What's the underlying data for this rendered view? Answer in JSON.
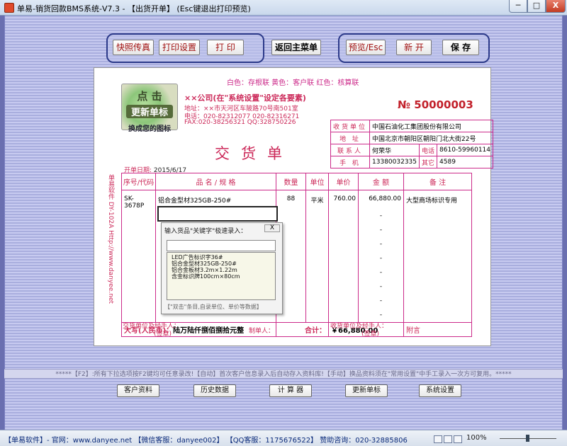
{
  "window": {
    "title": "单易-销货回款BMS系统-V7.3 - 【出货开单】     (Esc键退出打印预览)",
    "min_label": "─",
    "max_label": "□",
    "close_label": "X"
  },
  "toolbar": {
    "snapshot_fax": "快照传真",
    "print_settings": "打印设置",
    "print": "打 印",
    "back_main_menu": "返回主菜单",
    "preview_esc": "预览/Esc",
    "new_doc": "新 开",
    "save": "保 存"
  },
  "document": {
    "color_legend": "白色：存根联    黄色：客户联    红色：核算联",
    "logo": {
      "line1": "点 击",
      "line2": "更新单标",
      "line3": "换成您的图标"
    },
    "company_name": "××公司(在\"系统设置\"设定各要素)",
    "address": "地址：××市天河区车陂路70号南501室",
    "phone": "电话：020-82312077   020-82316271",
    "fax_qq": "FAX:020-38256321 QQ:328750226",
    "doc_number": "№ 50000003",
    "doc_title": "交货单",
    "date_label": "开单日期:",
    "date_value": "2015/6/17",
    "side_text": "单易软件 DY-102A  Http://www.danyee.net",
    "customer": {
      "unit_label": "收货单位",
      "unit_value": "中国石油化工集团股份有限公司",
      "addr_label": "地 址",
      "addr_value": "中国北京市朝阳区朝阳门北大街22号",
      "contact_label": "联系人",
      "contact_value": "何荣华",
      "phone_label": "电话",
      "phone_value": "8610-59960114",
      "mobile_label": "手 机",
      "mobile_value": "13380032335",
      "other_label": "其它",
      "other_value": "4589"
    },
    "columns": {
      "code": "序号/代码",
      "name": "品 名 / 规 格",
      "qty": "数量",
      "unit": "单位",
      "price": "单价",
      "amount": "金 额",
      "remark": "备 注"
    },
    "rows": [
      {
        "code": "SK-3678P",
        "name": "铝合金型材325GB-250#",
        "qty": "88",
        "unit": "平米",
        "price": "760.00",
        "amount": "66,880.00",
        "remark": "大型商场标识专用"
      }
    ],
    "dashes": [
      "-",
      "-",
      "-",
      "-",
      "-",
      "-",
      "-",
      "-"
    ],
    "total": {
      "upper_label": "大写(人民币)：",
      "upper_value": "陆万陆仟捌佰捌拾元整",
      "sum_label": "合计：",
      "sum_value": "￥66,880.00",
      "attach_label": "附言"
    },
    "footer": {
      "deliver": "交货单位及经手人：",
      "deliver_sign": "(签章)",
      "maker": "制单人：",
      "receive": "收货单位及经手人：",
      "receive_sign": "(签章)"
    }
  },
  "popup": {
    "title": "输入货品\"关键字\"极速录入：",
    "close": "X",
    "input_value": "",
    "items": [
      "LED广告标识字36#",
      "铝合金型材325GB-250#",
      "铝合金板材3.2m×1.22m",
      "含金标识牌100cm×80cm"
    ],
    "hint": "【\"双击\"条目,自录单位、单价等数据】"
  },
  "marquee": "*****【F2】:所有下拉选项按F2键均可任意录改!【自动】首次客户信息录入后自动存入资料库!【手动】换品资料须在\"常用设置\"中手工录入一次方可复用。*****",
  "bottom_buttons": {
    "customer_data": "客户资料",
    "history_data": "历史数据",
    "calculator": "计 算 器",
    "update_logo": "更新单标",
    "system_settings": "系统设置"
  },
  "status": {
    "text": "【单易软件】- 官网：www.danyee.net   【微信客服：danyee002】 【QQ客服：1175676522】   赞助咨询：020-32885806",
    "zoom": "100%"
  }
}
